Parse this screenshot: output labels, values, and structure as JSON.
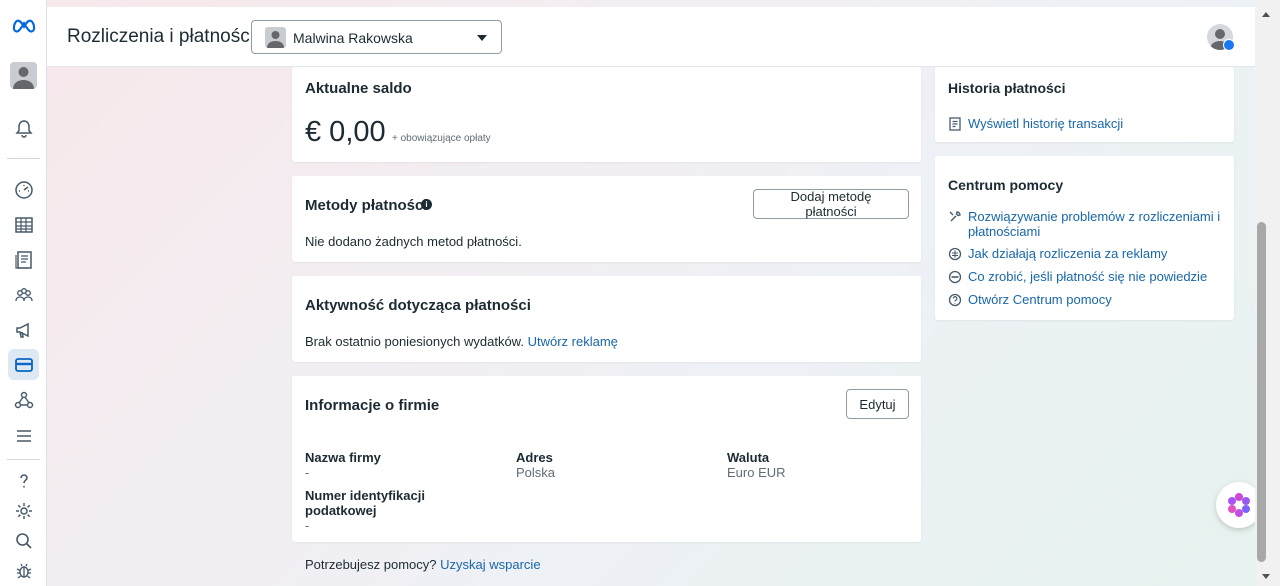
{
  "header": {
    "title": "Rozliczenia i płatności",
    "account_name": "Malwina Rakowska"
  },
  "balance": {
    "title": "Aktualne saldo",
    "amount": "€ 0,00",
    "note": "+ obowiązujące opłaty"
  },
  "payment_methods": {
    "title": "Metody płatności",
    "add_button": "Dodaj metodę płatności",
    "empty_text": "Nie dodano żadnych metod płatności."
  },
  "activity": {
    "title": "Aktywność dotycząca płatności",
    "text": "Brak ostatnio poniesionych wydatków.",
    "link": "Utwórz reklamę"
  },
  "company": {
    "title": "Informacje o firmie",
    "edit_button": "Edytuj",
    "fields": [
      {
        "label": "Nazwa firmy",
        "value": "-"
      },
      {
        "label": "Adres",
        "value": "Polska"
      },
      {
        "label": "Waluta",
        "value": "Euro EUR"
      },
      {
        "label": "Numer identyfikacji podatkowej",
        "value": "-"
      }
    ]
  },
  "payment_history": {
    "title": "Historia płatności",
    "link": "Wyświetl historię transakcji"
  },
  "help_center": {
    "title": "Centrum pomocy",
    "links": [
      {
        "label": "Rozwiązywanie problemów z rozliczeniami i płatnościami",
        "icon": "wrench-icon"
      },
      {
        "label": "Jak działają rozliczenia za reklamy",
        "icon": "billing-cycle-icon"
      },
      {
        "label": "Co zrobić, jeśli płatność się nie powiedzie",
        "icon": "no-entry-icon"
      },
      {
        "label": "Otwórz Centrum pomocy",
        "icon": "question-icon"
      }
    ]
  },
  "footer": {
    "text": "Potrzebujesz pomocy?",
    "link": "Uzyskaj wsparcie"
  },
  "colors": {
    "link": "#1867a9",
    "active_nav_bg": "#dde8f3",
    "meta_blue": "#0668e1"
  }
}
